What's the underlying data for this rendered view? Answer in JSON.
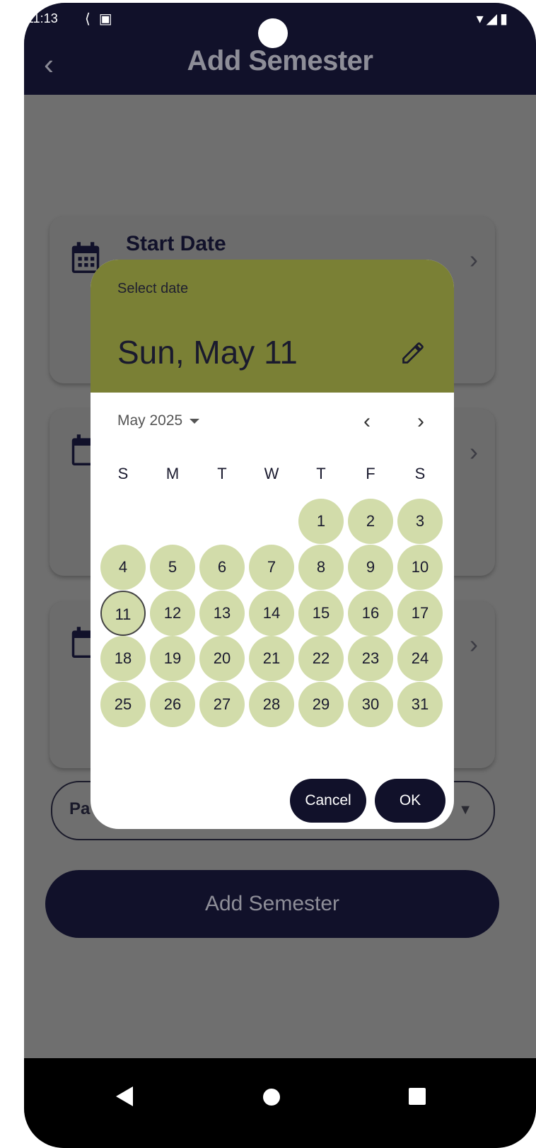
{
  "status_bar": {
    "time": "11:13"
  },
  "app_bar": {
    "title": "Add Semester",
    "back": "‹"
  },
  "form": {
    "start_date_label": "Start Date",
    "payment_label": "Pa",
    "submit_label": "Add Semester"
  },
  "date_picker": {
    "caption": "Select date",
    "selected_date": "Sun, May 11",
    "month_year": "May 2025",
    "weekdays": [
      "S",
      "M",
      "T",
      "W",
      "T",
      "F",
      "S"
    ],
    "first_weekday_index": 4,
    "days": [
      "1",
      "2",
      "3",
      "4",
      "5",
      "6",
      "7",
      "8",
      "9",
      "10",
      "11",
      "12",
      "13",
      "14",
      "15",
      "16",
      "17",
      "18",
      "19",
      "20",
      "21",
      "22",
      "23",
      "24",
      "25",
      "26",
      "27",
      "28",
      "29",
      "30",
      "31"
    ],
    "selected_day": "11",
    "cancel_label": "Cancel",
    "ok_label": "OK"
  },
  "colors": {
    "header_green": "#7a8035",
    "day_fill": "#d2dcaa",
    "dark_navy": "#11112a",
    "scrim_gray": "#6f6f6f"
  },
  "icons": {
    "calendar": "calendar-icon",
    "edit": "pencil-icon",
    "prev": "chevron-left-icon",
    "next": "chevron-right-icon",
    "dropdown": "caret-down-icon"
  }
}
